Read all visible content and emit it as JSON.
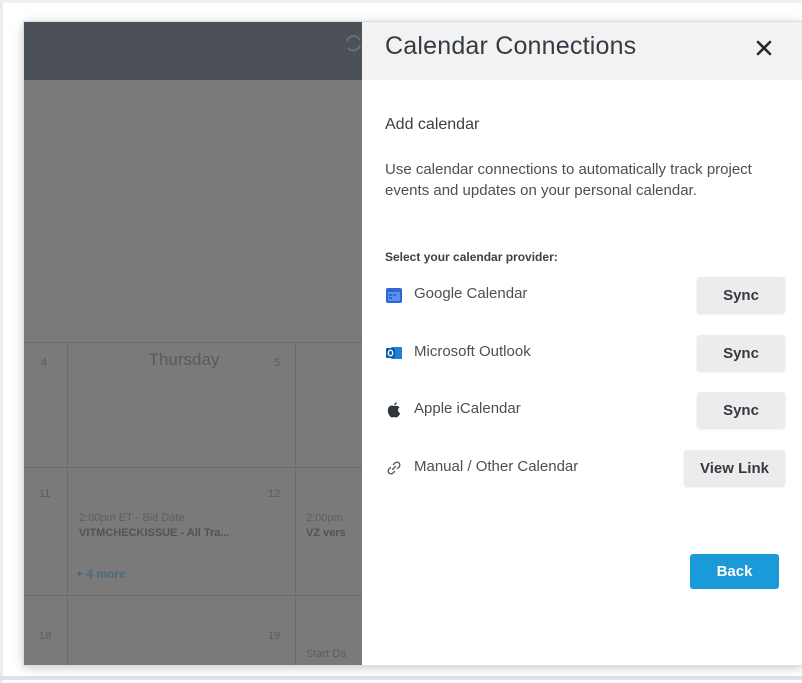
{
  "panel": {
    "title": "Calendar Connections",
    "section_title": "Add calendar",
    "description": "Use calendar connections to automatically track project events and updates on your personal calendar.",
    "provider_label": "Select your calendar provider:",
    "providers": [
      {
        "name": "Google Calendar",
        "icon": "google-calendar-icon",
        "action": "Sync"
      },
      {
        "name": "Microsoft Outlook",
        "icon": "outlook-icon",
        "action": "Sync"
      },
      {
        "name": "Apple iCalendar",
        "icon": "apple-icon",
        "action": "Sync"
      },
      {
        "name": "Manual / Other Calendar",
        "icon": "link-icon",
        "action": "View Link"
      }
    ],
    "back_label": "Back",
    "accent_color": "#1a9ad8"
  },
  "calendar": {
    "day_heading": "Thursday",
    "day_numbers": [
      "4",
      "5",
      "11",
      "12",
      "18",
      "19"
    ],
    "events": [
      {
        "time": "2:00pm ET - Bid Date",
        "title": "VITMCHECKISSUE - All Tra..."
      },
      {
        "time": "2:00pm",
        "title": "VZ vers"
      }
    ],
    "more_link": "+ 4 more",
    "start_text": "Start Da"
  }
}
